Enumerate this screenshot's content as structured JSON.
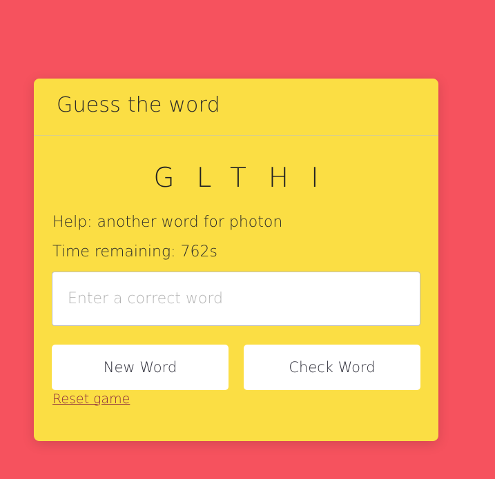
{
  "page": {
    "background_color": "#f6525e",
    "card_color": "#fbde44"
  },
  "card": {
    "title": "Guess the word",
    "scrambled_letters": "GLTHI",
    "help_text": "Help: another word for photon",
    "time_text": "Time remaining: 762s",
    "input": {
      "value": "",
      "placeholder": "Enter a correct word"
    },
    "buttons": {
      "new_word": "New Word",
      "check_word": "Check Word"
    },
    "reset_link": "Reset game"
  }
}
